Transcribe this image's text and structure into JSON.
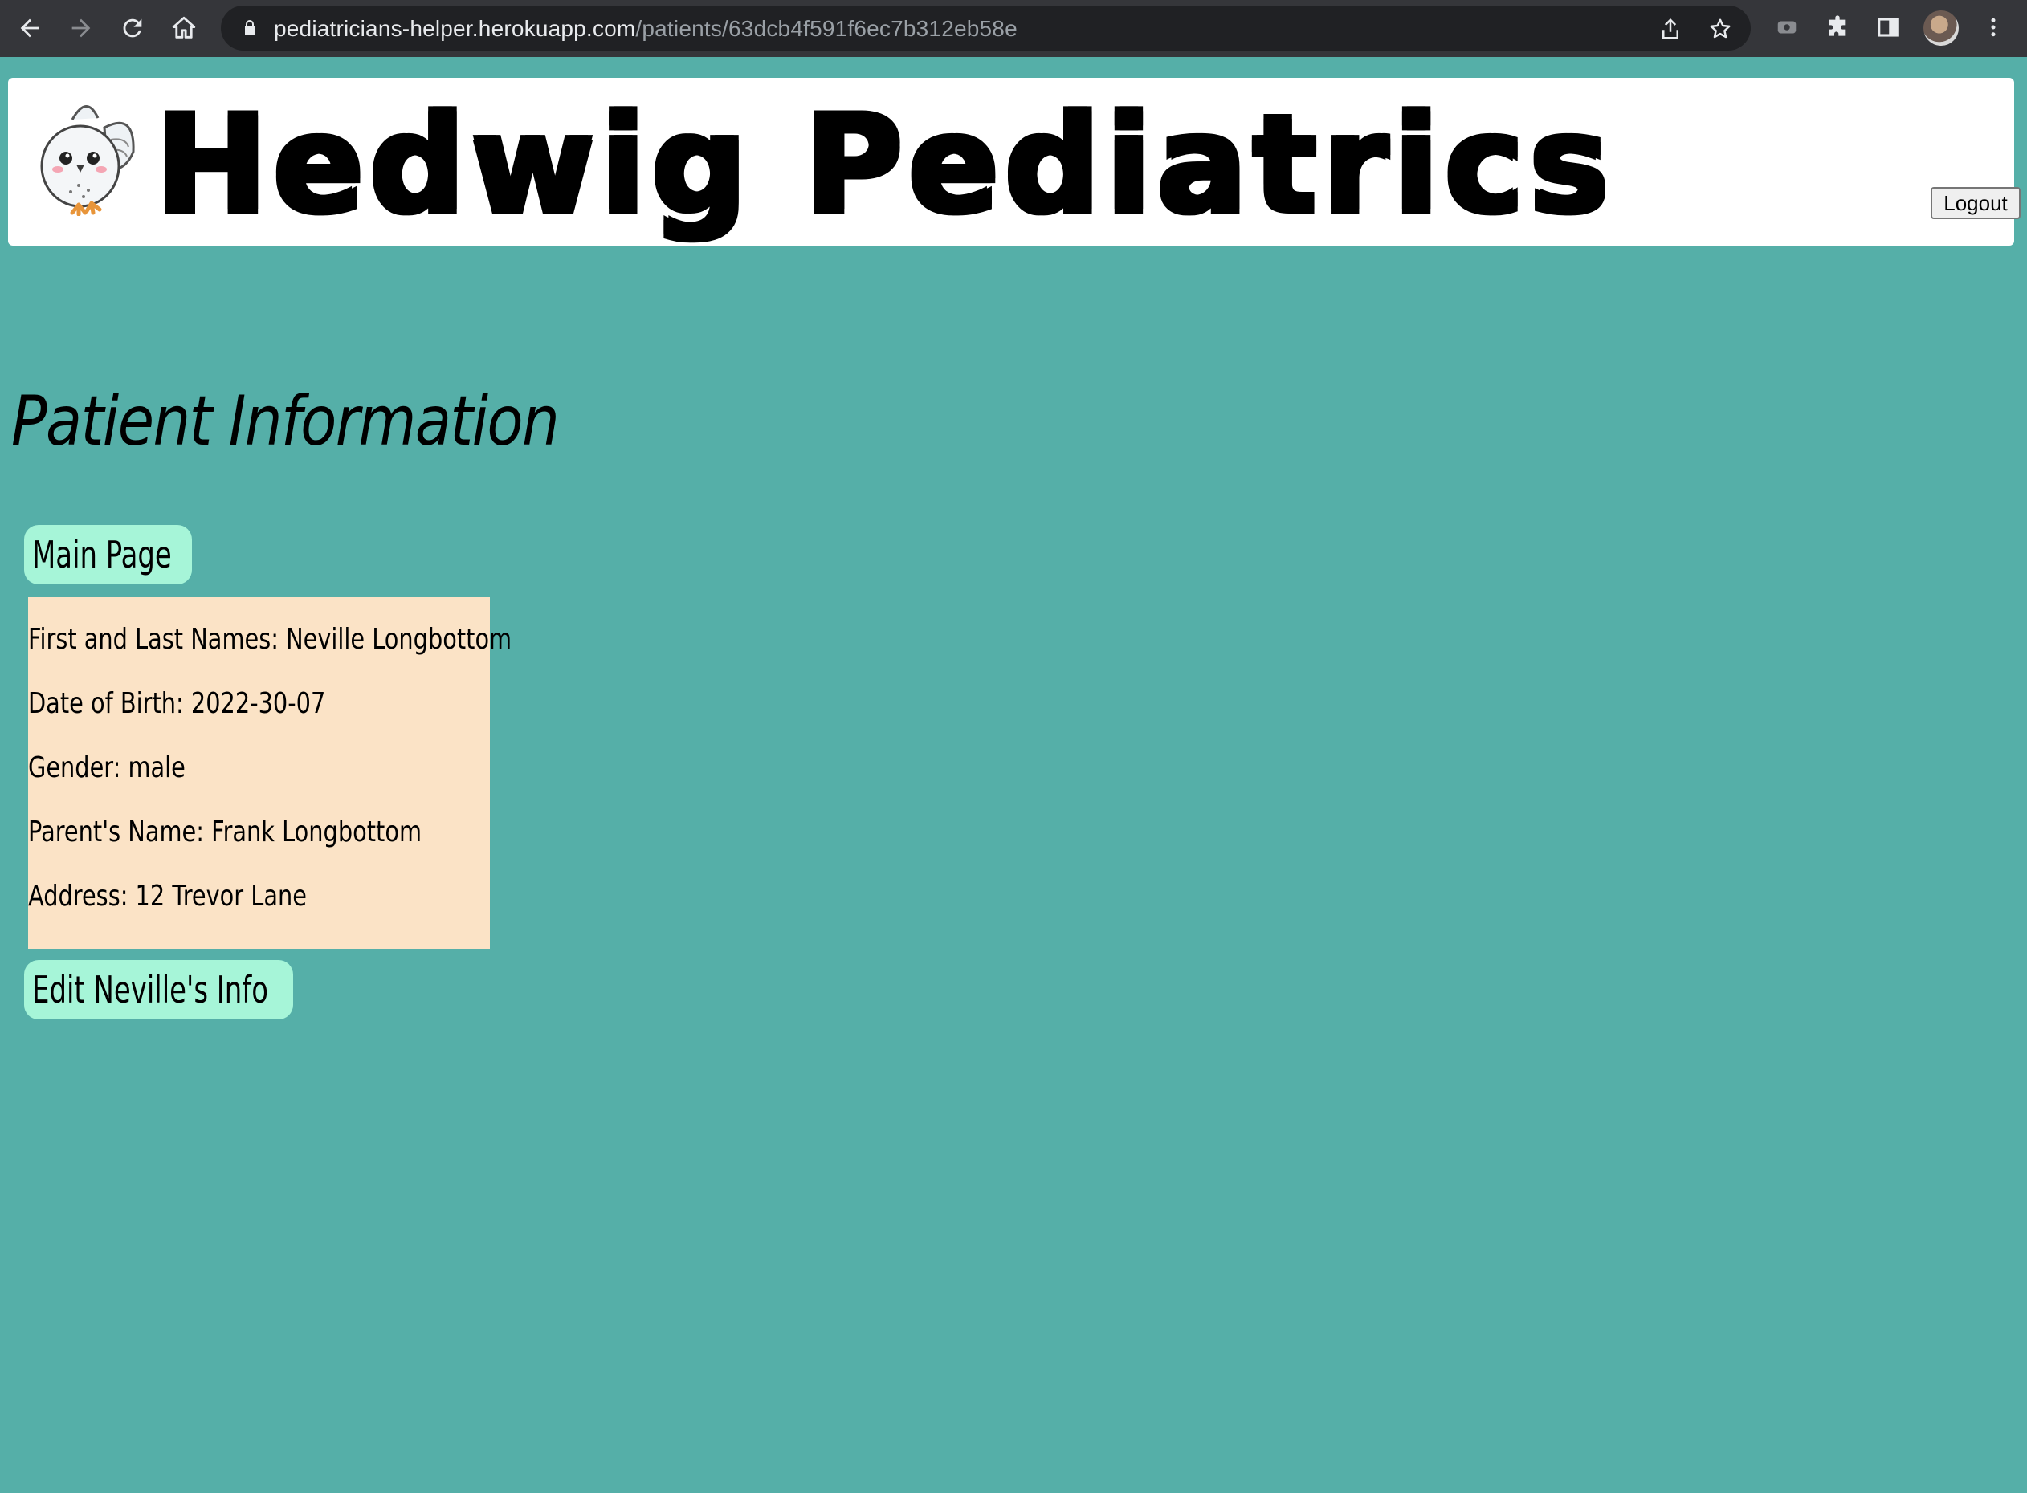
{
  "browser": {
    "url_host": "pediatricians-helper.herokuapp.com",
    "url_path": "/patients/63dcb4f591f6ec7b312eb58e"
  },
  "header": {
    "site_title": "Hedwig Pediatrics",
    "logout_label": "Logout"
  },
  "main": {
    "page_title": "Patient Information",
    "main_page_label": "Main Page",
    "patient": {
      "name_line": "First and Last Names: Neville Longbottom",
      "dob_line": "Date of Birth: 2022-30-07",
      "gender_line": "Gender: male",
      "parent_line": "Parent's Name: Frank Longbottom",
      "address_line": "Address: 12 Trevor Lane"
    },
    "edit_label": "Edit Neville's Info"
  },
  "colors": {
    "background": "#55afa8",
    "button_bg": "#a6f5d8",
    "card_bg": "#fbe3c6",
    "chrome_bg": "#35363a"
  }
}
